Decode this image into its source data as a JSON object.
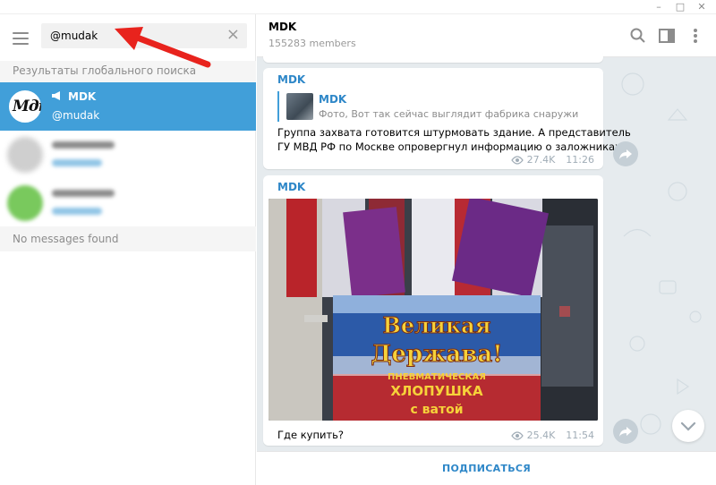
{
  "window": {
    "minimize_glyph": "–",
    "maximize_glyph": "□",
    "close_glyph": "✕"
  },
  "sidebar": {
    "search_value": "@mudak",
    "global_results_label": "Результаты глобального поиска",
    "results": [
      {
        "name": "MDK",
        "username": "@mudak",
        "avatar_logo": "Мдк",
        "selected": true,
        "type": "channel"
      },
      {
        "name": "",
        "username": "",
        "blurred": true
      },
      {
        "name": "",
        "username": "",
        "blurred": true
      }
    ],
    "no_messages_label": "No messages found"
  },
  "chat": {
    "title": "MDK",
    "subtitle": "155283 members",
    "messages": [
      {
        "author": "MDK",
        "reply_name": "MDK",
        "reply_text": "Фото, Вот так сейчас выглядит фабрика снаружи",
        "text_line1": "Группа захвата готовится штурмовать здание. А представитель",
        "text_line2": "ГУ МВД РФ по Москве опровергнул информацию о заложниках",
        "views": "27.4K",
        "time": "11:26"
      },
      {
        "author": "MDK",
        "photo_text_line1": "Великая",
        "photo_text_line2": "Держава!",
        "photo_text_line3": "ПНЕВМАТИЧЕСКАЯ",
        "photo_text_line4": "ХЛОПУШКА",
        "photo_text_line5": "с ватой",
        "text": "Где купить?",
        "views": "25.4K",
        "time": "11:54"
      }
    ],
    "subscribe_label": "ПОДПИСАТЬСЯ"
  },
  "colors": {
    "accent": "#419fd9",
    "link": "#2e87c8",
    "chat_bg": "#e6ebee",
    "arrow": "#e8231d"
  }
}
